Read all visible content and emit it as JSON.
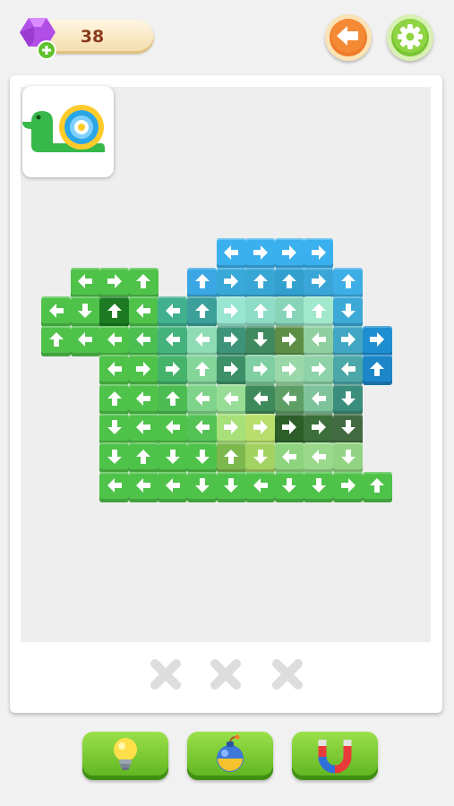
{
  "header": {
    "gem_count": "38",
    "gem_icon": "gem-plus-icon",
    "back_icon": "back-arrow-icon",
    "settings_icon": "gear-icon"
  },
  "colors": {
    "green": "#5cc346",
    "dark_green": "#1e8c2e",
    "blue": "#26a7e8",
    "teal": "#3c9f9a",
    "slot_gray": "#dddddd"
  },
  "target_picture": "snail-icon",
  "tiles": [
    {
      "row": 0,
      "col": 6,
      "dir": "left",
      "color": "#3ab0ee"
    },
    {
      "row": 0,
      "col": 7,
      "dir": "right",
      "color": "#3ab0ee"
    },
    {
      "row": 0,
      "col": 8,
      "dir": "right",
      "color": "#3ab0ee"
    },
    {
      "row": 0,
      "col": 9,
      "dir": "right",
      "color": "#3ab0ee"
    },
    {
      "row": 1,
      "col": 1,
      "dir": "left",
      "color": "#4fc24a"
    },
    {
      "row": 1,
      "col": 2,
      "dir": "right",
      "color": "#4fc24a"
    },
    {
      "row": 1,
      "col": 3,
      "dir": "up",
      "color": "#4fc24a"
    },
    {
      "row": 1,
      "col": 5,
      "dir": "up",
      "color": "#3aa7e4"
    },
    {
      "row": 1,
      "col": 6,
      "dir": "right",
      "color": "#38a8d8"
    },
    {
      "row": 1,
      "col": 7,
      "dir": "up",
      "color": "#37a6d4"
    },
    {
      "row": 1,
      "col": 8,
      "dir": "up",
      "color": "#32a0cf"
    },
    {
      "row": 1,
      "col": 9,
      "dir": "right",
      "color": "#3aa6d8"
    },
    {
      "row": 1,
      "col": 10,
      "dir": "up",
      "color": "#3eaee6"
    },
    {
      "row": 2,
      "col": 0,
      "dir": "left",
      "color": "#4fc24a"
    },
    {
      "row": 2,
      "col": 1,
      "dir": "down",
      "color": "#4fc24a"
    },
    {
      "row": 2,
      "col": 2,
      "dir": "up",
      "color": "#1b7a22"
    },
    {
      "row": 2,
      "col": 3,
      "dir": "left",
      "color": "#4fc24a"
    },
    {
      "row": 2,
      "col": 4,
      "dir": "left",
      "color": "#40b08e"
    },
    {
      "row": 2,
      "col": 5,
      "dir": "up",
      "color": "#3c9f9a"
    },
    {
      "row": 2,
      "col": 6,
      "dir": "right",
      "color": "#98e6d2"
    },
    {
      "row": 2,
      "col": 7,
      "dir": "up",
      "color": "#8edbc6"
    },
    {
      "row": 2,
      "col": 8,
      "dir": "up",
      "color": "#88d4b8"
    },
    {
      "row": 2,
      "col": 9,
      "dir": "up",
      "color": "#a2e8cc"
    },
    {
      "row": 2,
      "col": 10,
      "dir": "down",
      "color": "#3ca9d6"
    },
    {
      "row": 3,
      "col": 0,
      "dir": "up",
      "color": "#4fc24a"
    },
    {
      "row": 3,
      "col": 1,
      "dir": "left",
      "color": "#4fc24a"
    },
    {
      "row": 3,
      "col": 2,
      "dir": "left",
      "color": "#4fc24a"
    },
    {
      "row": 3,
      "col": 3,
      "dir": "left",
      "color": "#4bbf52"
    },
    {
      "row": 3,
      "col": 4,
      "dir": "left",
      "color": "#45b27c"
    },
    {
      "row": 3,
      "col": 5,
      "dir": "left",
      "color": "#8fdcb4"
    },
    {
      "row": 3,
      "col": 6,
      "dir": "right",
      "color": "#3e9479"
    },
    {
      "row": 3,
      "col": 7,
      "dir": "down",
      "color": "#418a5f"
    },
    {
      "row": 3,
      "col": 8,
      "dir": "right",
      "color": "#5e8e45"
    },
    {
      "row": 3,
      "col": 9,
      "dir": "left",
      "color": "#8fcfa0"
    },
    {
      "row": 3,
      "col": 10,
      "dir": "right",
      "color": "#42a7c2"
    },
    {
      "row": 3,
      "col": 11,
      "dir": "right",
      "color": "#1f8ed0"
    },
    {
      "row": 4,
      "col": 2,
      "dir": "left",
      "color": "#4fc24a"
    },
    {
      "row": 4,
      "col": 3,
      "dir": "right",
      "color": "#4fc24a"
    },
    {
      "row": 4,
      "col": 4,
      "dir": "right",
      "color": "#46b36a"
    },
    {
      "row": 4,
      "col": 5,
      "dir": "up",
      "color": "#84d59a"
    },
    {
      "row": 4,
      "col": 6,
      "dir": "right",
      "color": "#3d9068"
    },
    {
      "row": 4,
      "col": 7,
      "dir": "right",
      "color": "#80cfa2"
    },
    {
      "row": 4,
      "col": 8,
      "dir": "right",
      "color": "#9ad8aa"
    },
    {
      "row": 4,
      "col": 9,
      "dir": "right",
      "color": "#8ed2a8"
    },
    {
      "row": 4,
      "col": 10,
      "dir": "left",
      "color": "#4ca7a8"
    },
    {
      "row": 4,
      "col": 11,
      "dir": "up",
      "color": "#1c86c8"
    },
    {
      "row": 5,
      "col": 2,
      "dir": "up",
      "color": "#4fc24a"
    },
    {
      "row": 5,
      "col": 3,
      "dir": "left",
      "color": "#4fc24a"
    },
    {
      "row": 5,
      "col": 4,
      "dir": "up",
      "color": "#4cbc52"
    },
    {
      "row": 5,
      "col": 5,
      "dir": "left",
      "color": "#7fd38a"
    },
    {
      "row": 5,
      "col": 6,
      "dir": "left",
      "color": "#98dd96"
    },
    {
      "row": 5,
      "col": 7,
      "dir": "left",
      "color": "#3f8a5a"
    },
    {
      "row": 5,
      "col": 8,
      "dir": "left",
      "color": "#5e9f66"
    },
    {
      "row": 5,
      "col": 9,
      "dir": "left",
      "color": "#7ec39a"
    },
    {
      "row": 5,
      "col": 10,
      "dir": "down",
      "color": "#3c8e7c"
    },
    {
      "row": 6,
      "col": 2,
      "dir": "down",
      "color": "#4fc24a"
    },
    {
      "row": 6,
      "col": 3,
      "dir": "left",
      "color": "#4fc24a"
    },
    {
      "row": 6,
      "col": 4,
      "dir": "left",
      "color": "#4fc24a"
    },
    {
      "row": 6,
      "col": 5,
      "dir": "left",
      "color": "#55c255"
    },
    {
      "row": 6,
      "col": 6,
      "dir": "right",
      "color": "#a8e07a"
    },
    {
      "row": 6,
      "col": 7,
      "dir": "right",
      "color": "#b8de6e"
    },
    {
      "row": 6,
      "col": 8,
      "dir": "right",
      "color": "#2d5e2a"
    },
    {
      "row": 6,
      "col": 9,
      "dir": "right",
      "color": "#3c6f3b"
    },
    {
      "row": 6,
      "col": 10,
      "dir": "down",
      "color": "#426b42"
    },
    {
      "row": 7,
      "col": 2,
      "dir": "down",
      "color": "#4fc24a"
    },
    {
      "row": 7,
      "col": 3,
      "dir": "up",
      "color": "#4fc24a"
    },
    {
      "row": 7,
      "col": 4,
      "dir": "down",
      "color": "#4fc24a"
    },
    {
      "row": 7,
      "col": 5,
      "dir": "down",
      "color": "#4fc24a"
    },
    {
      "row": 7,
      "col": 6,
      "dir": "up",
      "color": "#7cb84e"
    },
    {
      "row": 7,
      "col": 7,
      "dir": "down",
      "color": "#a2d262"
    },
    {
      "row": 7,
      "col": 8,
      "dir": "left",
      "color": "#8ed47e"
    },
    {
      "row": 7,
      "col": 9,
      "dir": "left",
      "color": "#9ad88c"
    },
    {
      "row": 7,
      "col": 10,
      "dir": "down",
      "color": "#92d484"
    },
    {
      "row": 8,
      "col": 2,
      "dir": "left",
      "color": "#4fc24a"
    },
    {
      "row": 8,
      "col": 3,
      "dir": "left",
      "color": "#4fc24a"
    },
    {
      "row": 8,
      "col": 4,
      "dir": "left",
      "color": "#4fc24a"
    },
    {
      "row": 8,
      "col": 5,
      "dir": "down",
      "color": "#4fc24a"
    },
    {
      "row": 8,
      "col": 6,
      "dir": "down",
      "color": "#4fc24a"
    },
    {
      "row": 8,
      "col": 7,
      "dir": "left",
      "color": "#4fc24a"
    },
    {
      "row": 8,
      "col": 8,
      "dir": "down",
      "color": "#4fc24a"
    },
    {
      "row": 8,
      "col": 9,
      "dir": "down",
      "color": "#4fc24a"
    },
    {
      "row": 8,
      "col": 10,
      "dir": "right",
      "color": "#4fc24a"
    },
    {
      "row": 8,
      "col": 11,
      "dir": "up",
      "color": "#4fc24a"
    }
  ],
  "slots": [
    {
      "icon": "empty-slot-x-icon"
    },
    {
      "icon": "empty-slot-x-icon"
    },
    {
      "icon": "empty-slot-x-icon"
    }
  ],
  "boosters": [
    {
      "name": "hint-booster-button",
      "icon": "lightbulb-icon"
    },
    {
      "name": "bomb-booster-button",
      "icon": "bomb-icon"
    },
    {
      "name": "magnet-booster-button",
      "icon": "magnet-icon"
    }
  ]
}
